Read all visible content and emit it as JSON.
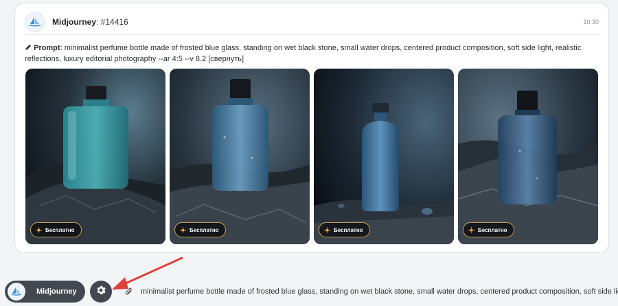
{
  "message": {
    "bot_name": "Midjourney",
    "number": ": #14416",
    "time": "10:30",
    "prompt_label": "Prompt",
    "prompt_text": ":  minimalist perfume bottle made of frosted blue glass, standing on wet black stone, small water drops, centered product composition, soft side light, realistic reflections, luxury editorial photography --ar 4:5 --v 8.2",
    "collapse_label": "[свернуть]",
    "images": [
      {
        "badge": "Бесплатно",
        "icon": "image-perfume-1"
      },
      {
        "badge": "Бесплатно",
        "icon": "image-perfume-2"
      },
      {
        "badge": "Бесплатно",
        "icon": "image-perfume-3"
      },
      {
        "badge": "Бесплатно",
        "icon": "image-perfume-4"
      }
    ]
  },
  "composer": {
    "model_label": "Midjourney",
    "input_value": "minimalist perfume bottle made of frosted blue glass, standing on wet black stone, small water drops, centered product composition, soft side light",
    "icons": [
      "settings-icon",
      "paperclip-icon",
      "sailboat-logo-icon"
    ]
  },
  "colors": {
    "accent_badge_border": "#c9a24a",
    "pill_bg": "#43474f",
    "arrow": "#e0413a"
  }
}
